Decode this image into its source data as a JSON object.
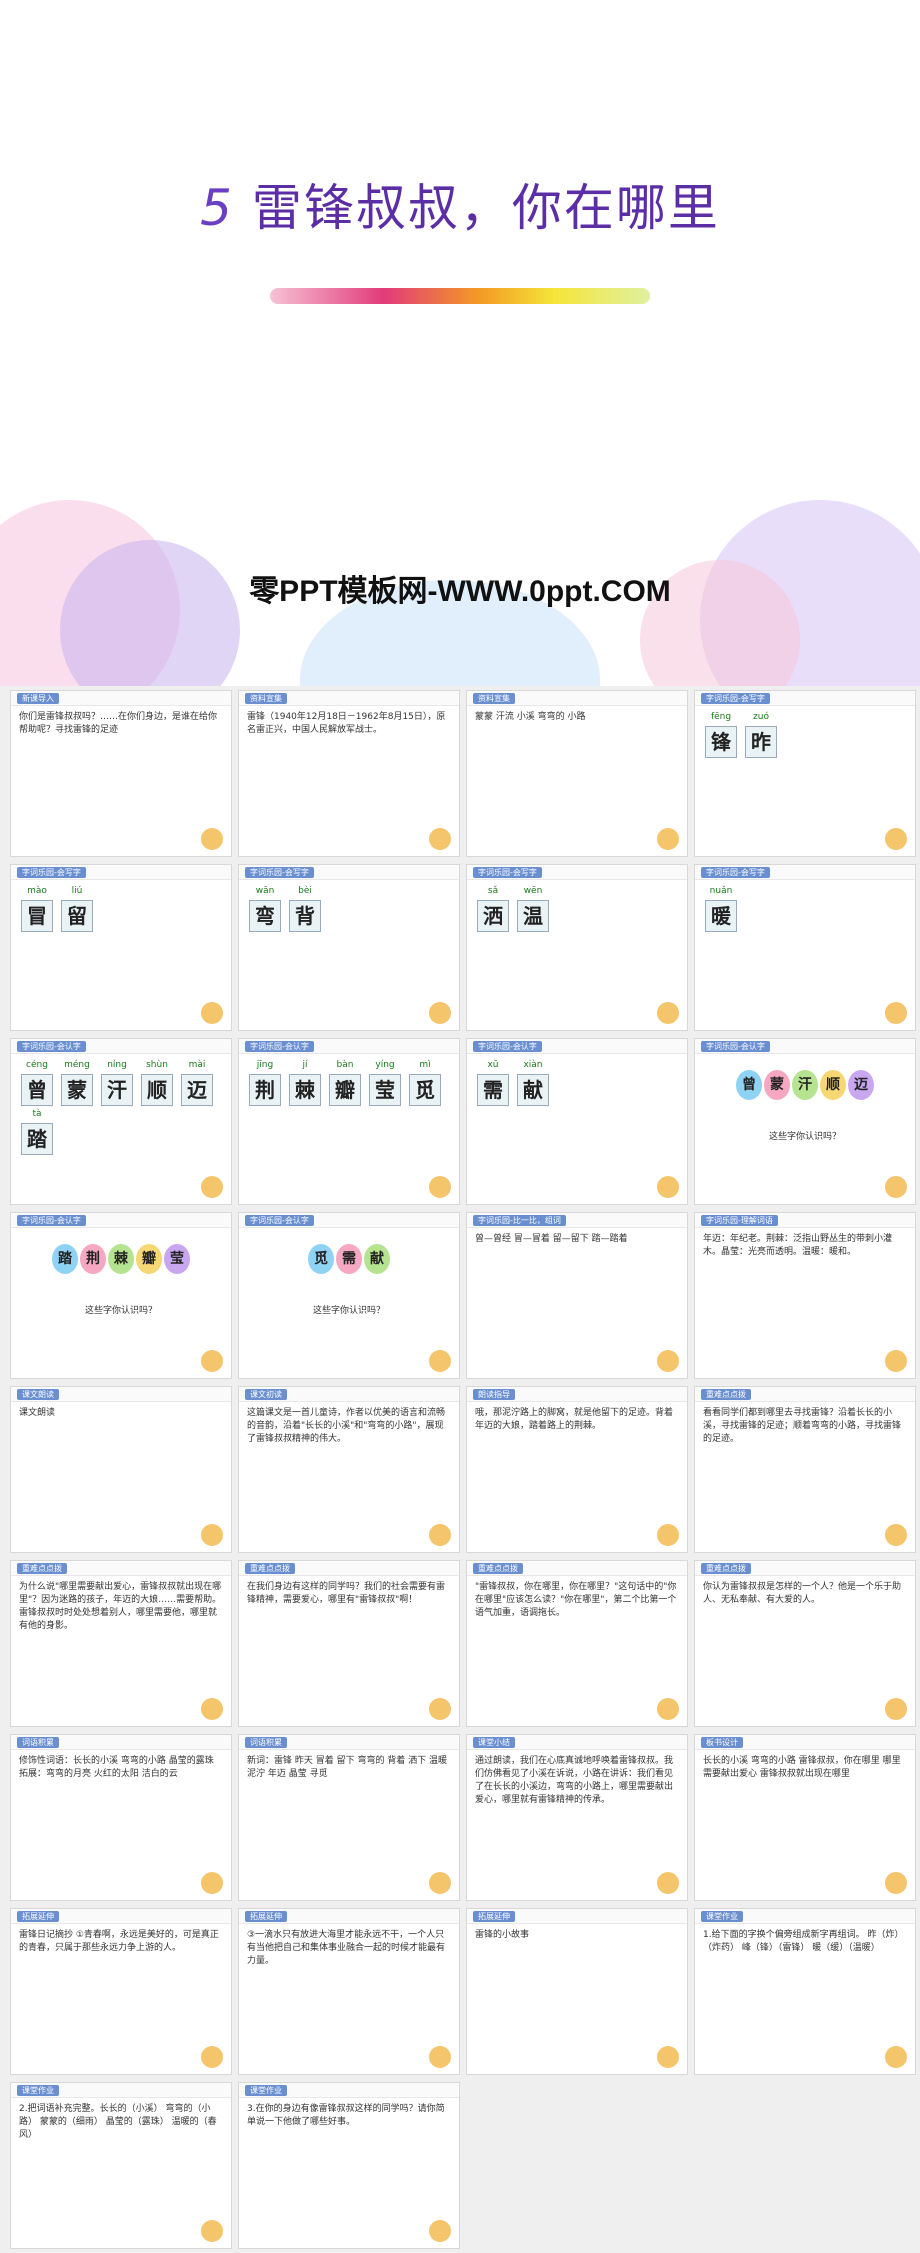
{
  "cover": {
    "number": "5",
    "title": "雷锋叔叔，你在哪里",
    "brand": "零PPT模板网-WWW.0ppt.COM"
  },
  "slides": [
    {
      "tag": "新课导入",
      "text": "你们是雷锋叔叔吗？……在你们身边，是谁在给你帮助呢？寻找雷锋的足迹"
    },
    {
      "tag": "资料宣集",
      "text": "雷锋（1940年12月18日－1962年8月15日），原名雷正兴，中国人民解放军战士。"
    },
    {
      "tag": "资料宣集",
      "text": "蒙蒙 汗流 小溪 弯弯的 小路"
    },
    {
      "tag": "字词乐园-会写字",
      "chars": [
        "锋",
        "昨"
      ],
      "pinyin": [
        "fēng",
        "zuó"
      ]
    },
    {
      "tag": "字词乐园-会写字",
      "chars": [
        "冒",
        "留"
      ],
      "pinyin": [
        "mào",
        "liú"
      ]
    },
    {
      "tag": "字词乐园-会写字",
      "chars": [
        "弯",
        "背"
      ],
      "pinyin": [
        "wān",
        "bèi"
      ]
    },
    {
      "tag": "字词乐园-会写字",
      "chars": [
        "洒",
        "温"
      ],
      "pinyin": [
        "sǎ",
        "wēn"
      ]
    },
    {
      "tag": "字词乐园-会写字",
      "chars": [
        "暖"
      ],
      "pinyin": [
        "nuǎn"
      ]
    },
    {
      "tag": "字词乐园-会认字",
      "chars": [
        "曾",
        "蒙",
        "汗",
        "顺",
        "迈",
        "踏"
      ],
      "pinyin": [
        "céng",
        "méng",
        "níng",
        "shùn",
        "mài",
        "tà"
      ]
    },
    {
      "tag": "字词乐园-会认字",
      "chars": [
        "荆",
        "棘",
        "瓣",
        "莹",
        "觅"
      ],
      "pinyin": [
        "jīng",
        "jí",
        "bàn",
        "yíng",
        "mì"
      ]
    },
    {
      "tag": "字词乐园-会认字",
      "chars": [
        "需",
        "献"
      ],
      "pinyin": [
        "xū",
        "xiàn"
      ]
    },
    {
      "tag": "字词乐园-会认字",
      "balloons": [
        "曾",
        "蒙",
        "汗",
        "顺",
        "迈"
      ],
      "note": "这些字你认识吗？"
    },
    {
      "tag": "字词乐园-会认字",
      "balloons": [
        "踏",
        "荆",
        "棘",
        "瓣",
        "莹"
      ],
      "note": "这些字你认识吗？"
    },
    {
      "tag": "字词乐园-会认字",
      "balloons": [
        "觅",
        "需",
        "献"
      ],
      "note": "这些字你认识吗？"
    },
    {
      "tag": "字词乐园-比一比，组词",
      "text": "曾—曾经 冒—冒着 留—留下 踏—踏着"
    },
    {
      "tag": "字词乐园-理解词语",
      "text": "年迈：年纪老。荆棘：泛指山野丛生的带刺小灌木。晶莹：光亮而透明。温暖：暖和。"
    },
    {
      "tag": "课文朗读",
      "text": "课文朗读"
    },
    {
      "tag": "课文初读",
      "text": "这篇课文是一首儿童诗，作者以优美的语言和流畅的音韵，沿着\"长长的小溪\"和\"弯弯的小路\"，展现了雷锋叔叔精神的伟大。"
    },
    {
      "tag": "朗读指导",
      "text": "哦，那泥泞路上的脚窝，就是他留下的足迹。背着年迈的大娘，踏着路上的荆棘。"
    },
    {
      "tag": "重难点点拨",
      "text": "看看同学们都到哪里去寻找雷锋？沿着长长的小溪，寻找雷锋的足迹；顺着弯弯的小路，寻找雷锋的足迹。"
    },
    {
      "tag": "重难点点拨",
      "text": "为什么说\"哪里需要献出爱心，雷锋叔叔就出现在哪里\"？因为迷路的孩子，年迈的大娘……需要帮助。雷锋叔叔时时处处想着别人，哪里需要他，哪里就有他的身影。"
    },
    {
      "tag": "重难点点拨",
      "text": "在我们身边有这样的同学吗？我们的社会需要有雷锋精神，需要爱心，哪里有\"雷锋叔叔\"啊！"
    },
    {
      "tag": "重难点点拨",
      "text": "\"雷锋叔叔，你在哪里，你在哪里？\"这句话中的\"你在哪里\"应该怎么读？\"你在哪里\"，第二个比第一个语气加重，语调拖长。"
    },
    {
      "tag": "重难点点拨",
      "text": "你认为雷锋叔叔是怎样的一个人？他是一个乐于助人、无私奉献、有大爱的人。"
    },
    {
      "tag": "词语积累",
      "text": "修饰性词语：长长的小溪 弯弯的小路 晶莹的露珠 拓展：弯弯的月亮 火红的太阳 洁白的云"
    },
    {
      "tag": "词语积累",
      "text": "新词：雷锋 昨天 冒着 留下 弯弯的 背着 洒下 温暖 泥泞 年迈 晶莹 寻觅"
    },
    {
      "tag": "课堂小结",
      "text": "通过朗读，我们在心底真诚地呼唤着雷锋叔叔。我们仿佛看见了小溪在诉说，小路在讲诉：我们看见了在长长的小溪边，弯弯的小路上，哪里需要献出爱心，哪里就有雷锋精神的传承。"
    },
    {
      "tag": "板书设计",
      "text": "长长的小溪 弯弯的小路 雷锋叔叔，你在哪里 哪里需要献出爱心 雷锋叔叔就出现在哪里"
    },
    {
      "tag": "拓展延伸",
      "text": "雷锋日记摘抄 ①青春啊，永远是美好的，可是真正的青春，只属于那些永远力争上游的人。"
    },
    {
      "tag": "拓展延伸",
      "text": "③一滴水只有放进大海里才能永远不干，一个人只有当他把自己和集体事业融合一起的时候才能最有力量。"
    },
    {
      "tag": "拓展延伸",
      "text": "雷锋的小故事"
    },
    {
      "tag": "课堂作业",
      "text": "1.给下面的字换个偏旁组成新字再组词。 昨（炸）（炸药） 峰（锋）（雷锋） 暖（缓）（温暖）"
    },
    {
      "tag": "课堂作业",
      "text": "2.把词语补充完整。长长的（小溪） 弯弯的（小路） 蒙蒙的（细雨） 晶莹的（露珠） 温暖的（春风）"
    },
    {
      "tag": "课堂作业",
      "text": "3.在你的身边有像雷锋叔叔这样的同学吗？请你简单说一下他做了哪些好事。"
    }
  ]
}
